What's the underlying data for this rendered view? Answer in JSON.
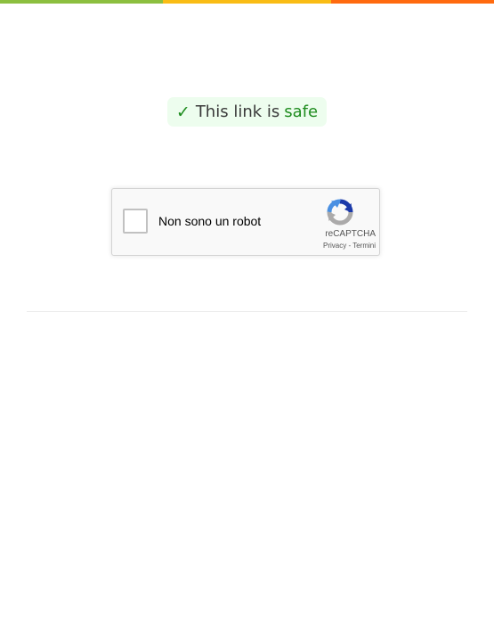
{
  "colors": {
    "bar_green": "#8cbf3f",
    "bar_yellow": "#f9bc15",
    "bar_orange": "#ff6a0f",
    "safe_green": "#1e8c1e",
    "badge_bg": "#edfdee",
    "captcha_bg": "#f9f9f9"
  },
  "safety": {
    "check_icon": "✓",
    "text": "This link is",
    "status": "safe"
  },
  "captcha": {
    "label": "Non sono un robot",
    "brand": "reCAPTCHA",
    "privacy": "Privacy",
    "separator": " - ",
    "terms": "Termini"
  }
}
